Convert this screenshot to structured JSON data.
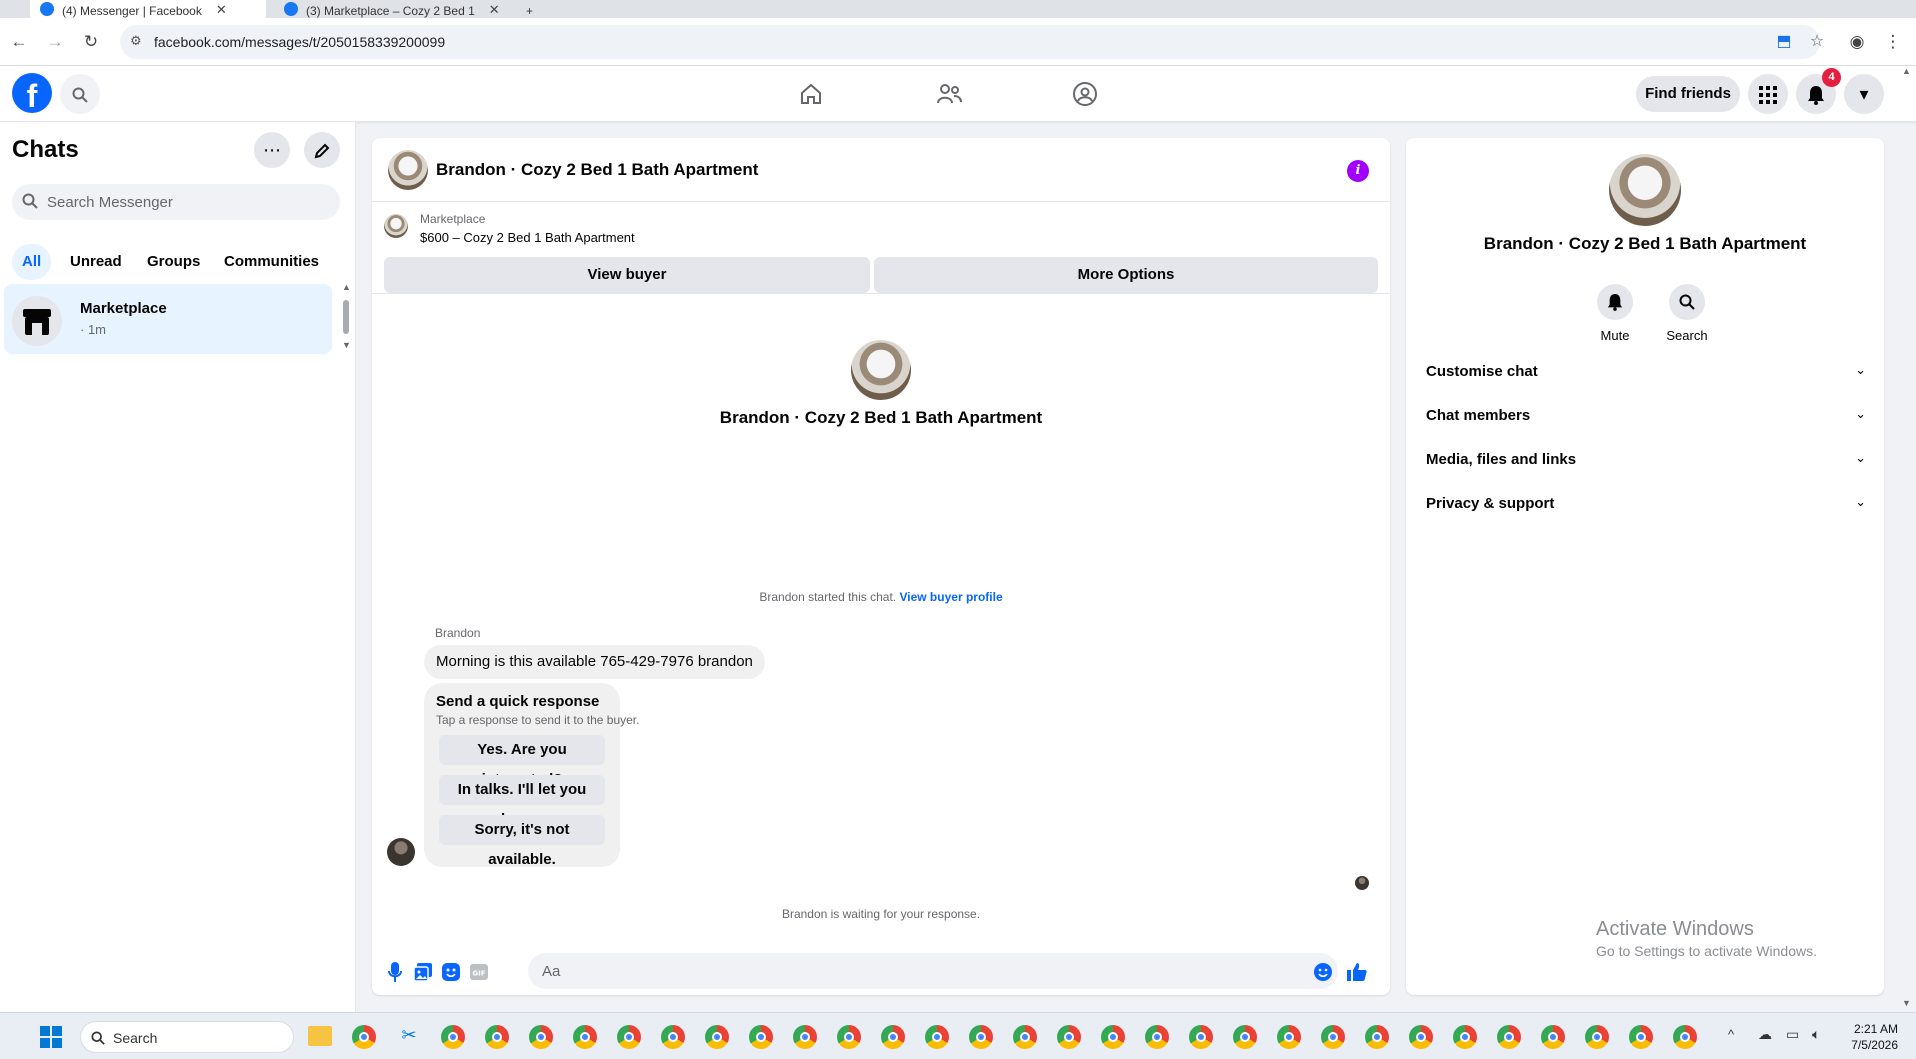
{
  "browser": {
    "tabs": [
      {
        "title": "(4) Messenger | Facebook"
      },
      {
        "title": "(3) Marketplace – Cozy 2 Bed 1"
      }
    ],
    "new_tab": "+",
    "url": "facebook.com/messages/t/2050158339200099"
  },
  "header": {
    "logo": "f",
    "find_friends": "Find friends",
    "notification_count": "4"
  },
  "sidebar": {
    "title": "Chats",
    "search_placeholder": "Search Messenger",
    "filters": [
      "All",
      "Unread",
      "Groups",
      "Communities"
    ],
    "chats": [
      {
        "name": "Marketplace",
        "time": "· 1m"
      }
    ]
  },
  "conversation": {
    "title": "Brandon · Cozy 2 Bed 1 Bath Apartment",
    "marketplace_label": "Marketplace",
    "product": "$600 – Cozy 2 Bed 1 Bath Apartment",
    "view_buyer": "View buyer",
    "more_options": "More Options",
    "intro_name": "Brandon · Cozy 2 Bed 1 Bath Apartment",
    "started_text": "Brandon started this chat.",
    "view_profile": "View buyer profile",
    "sender": "Brandon",
    "message": "Morning is this available 765-429-7976 brandon",
    "quick_title": "Send a quick response",
    "quick_sub": "Tap a response to send it to the buyer.",
    "quick_responses": [
      "Yes. Are you interested?",
      "In talks. I'll let you know.",
      "Sorry, it's not available."
    ],
    "waiting": "Brandon is waiting for your response.",
    "input_placeholder": "Aa"
  },
  "details": {
    "name": "Brandon · Cozy 2 Bed 1 Bath Apartment",
    "mute": "Mute",
    "search": "Search",
    "sections": [
      "Customise chat",
      "Chat members",
      "Media, files and links",
      "Privacy & support"
    ]
  },
  "watermark": {
    "line1": "Activate Windows",
    "line2": "Go to Settings to activate Windows."
  },
  "taskbar": {
    "search_placeholder": "Search",
    "time": "2:21 AM",
    "date": "7/5/2026"
  },
  "colors": {
    "fb_blue": "#0866ff",
    "info_purple": "#a100ff",
    "badge_red": "#e41e3f"
  }
}
